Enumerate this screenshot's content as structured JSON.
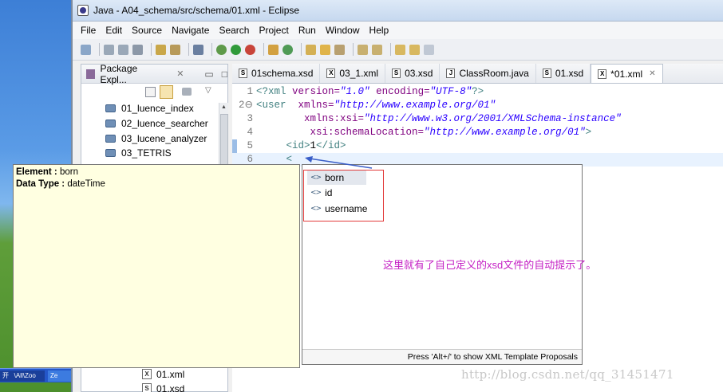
{
  "window": {
    "title": "Java - A04_schema/src/schema/01.xml - Eclipse"
  },
  "menu": [
    "File",
    "Edit",
    "Source",
    "Navigate",
    "Search",
    "Project",
    "Run",
    "Window",
    "Help"
  ],
  "package_explorer": {
    "title": "Package Expl...",
    "items": [
      "01_luence_index",
      "02_luence_searcher",
      "03_lucene_analyzer",
      "03_TETRIS"
    ],
    "bottom_files": [
      {
        "icon": "X",
        "name": "01.xml"
      },
      {
        "icon": "S",
        "name": "01.xsd"
      }
    ]
  },
  "tabs": [
    {
      "icon": "S",
      "label": "01schema.xsd"
    },
    {
      "icon": "X",
      "label": "03_1.xml"
    },
    {
      "icon": "S",
      "label": "03.xsd"
    },
    {
      "icon": "J",
      "label": "ClassRoom.java"
    },
    {
      "icon": "S",
      "label": "01.xsd"
    },
    {
      "icon": "X",
      "label": "*01.xml",
      "active": true,
      "close": "✕"
    }
  ],
  "editor": {
    "line_numbers": [
      "1",
      "2⊖",
      "3",
      "4",
      "5",
      "6"
    ],
    "l1": {
      "a": "<?",
      "b": "xml",
      "c": " version=",
      "d": "\"1.0\"",
      "e": " encoding=",
      "f": "\"UTF-8\"",
      "g": "?>"
    },
    "l2": {
      "a": "<user",
      "b": "  xmlns=",
      "c": "\"http://www.example.org/01\""
    },
    "l3": {
      "a": "        xmlns:xsi=",
      "b": "\"http://www.w3.org/2001/XMLSchema-instance\""
    },
    "l4": {
      "a": "         xsi:schemaLocation=",
      "b": "\"http://www.example.org/01\"",
      "c": ">"
    },
    "l5": {
      "a": "     <id>",
      "b": "1",
      "c": "</id>"
    },
    "l6": {
      "a": "     <"
    }
  },
  "tooltip": {
    "element_label": "Element :",
    "element_value": " born",
    "type_label": "Data Type :",
    "type_value": " dateTime"
  },
  "completion": {
    "items": [
      "born",
      "id",
      "username"
    ],
    "tag_icon": "<>",
    "footer": "Press 'Alt+/' to show XML Template Proposals"
  },
  "annotation": "这里就有了自己定义的xsd文件的自动提示了。",
  "watermark": "http://blog.csdn.net/qq_31451471",
  "taskbar": {
    "left_text": "开   \\All\\Zoo",
    "right_text": "Ze"
  },
  "colors": {
    "annotation": "#c41fc4",
    "redbox": "#e23a3a",
    "tooltip_bg": "#ffffe1"
  }
}
